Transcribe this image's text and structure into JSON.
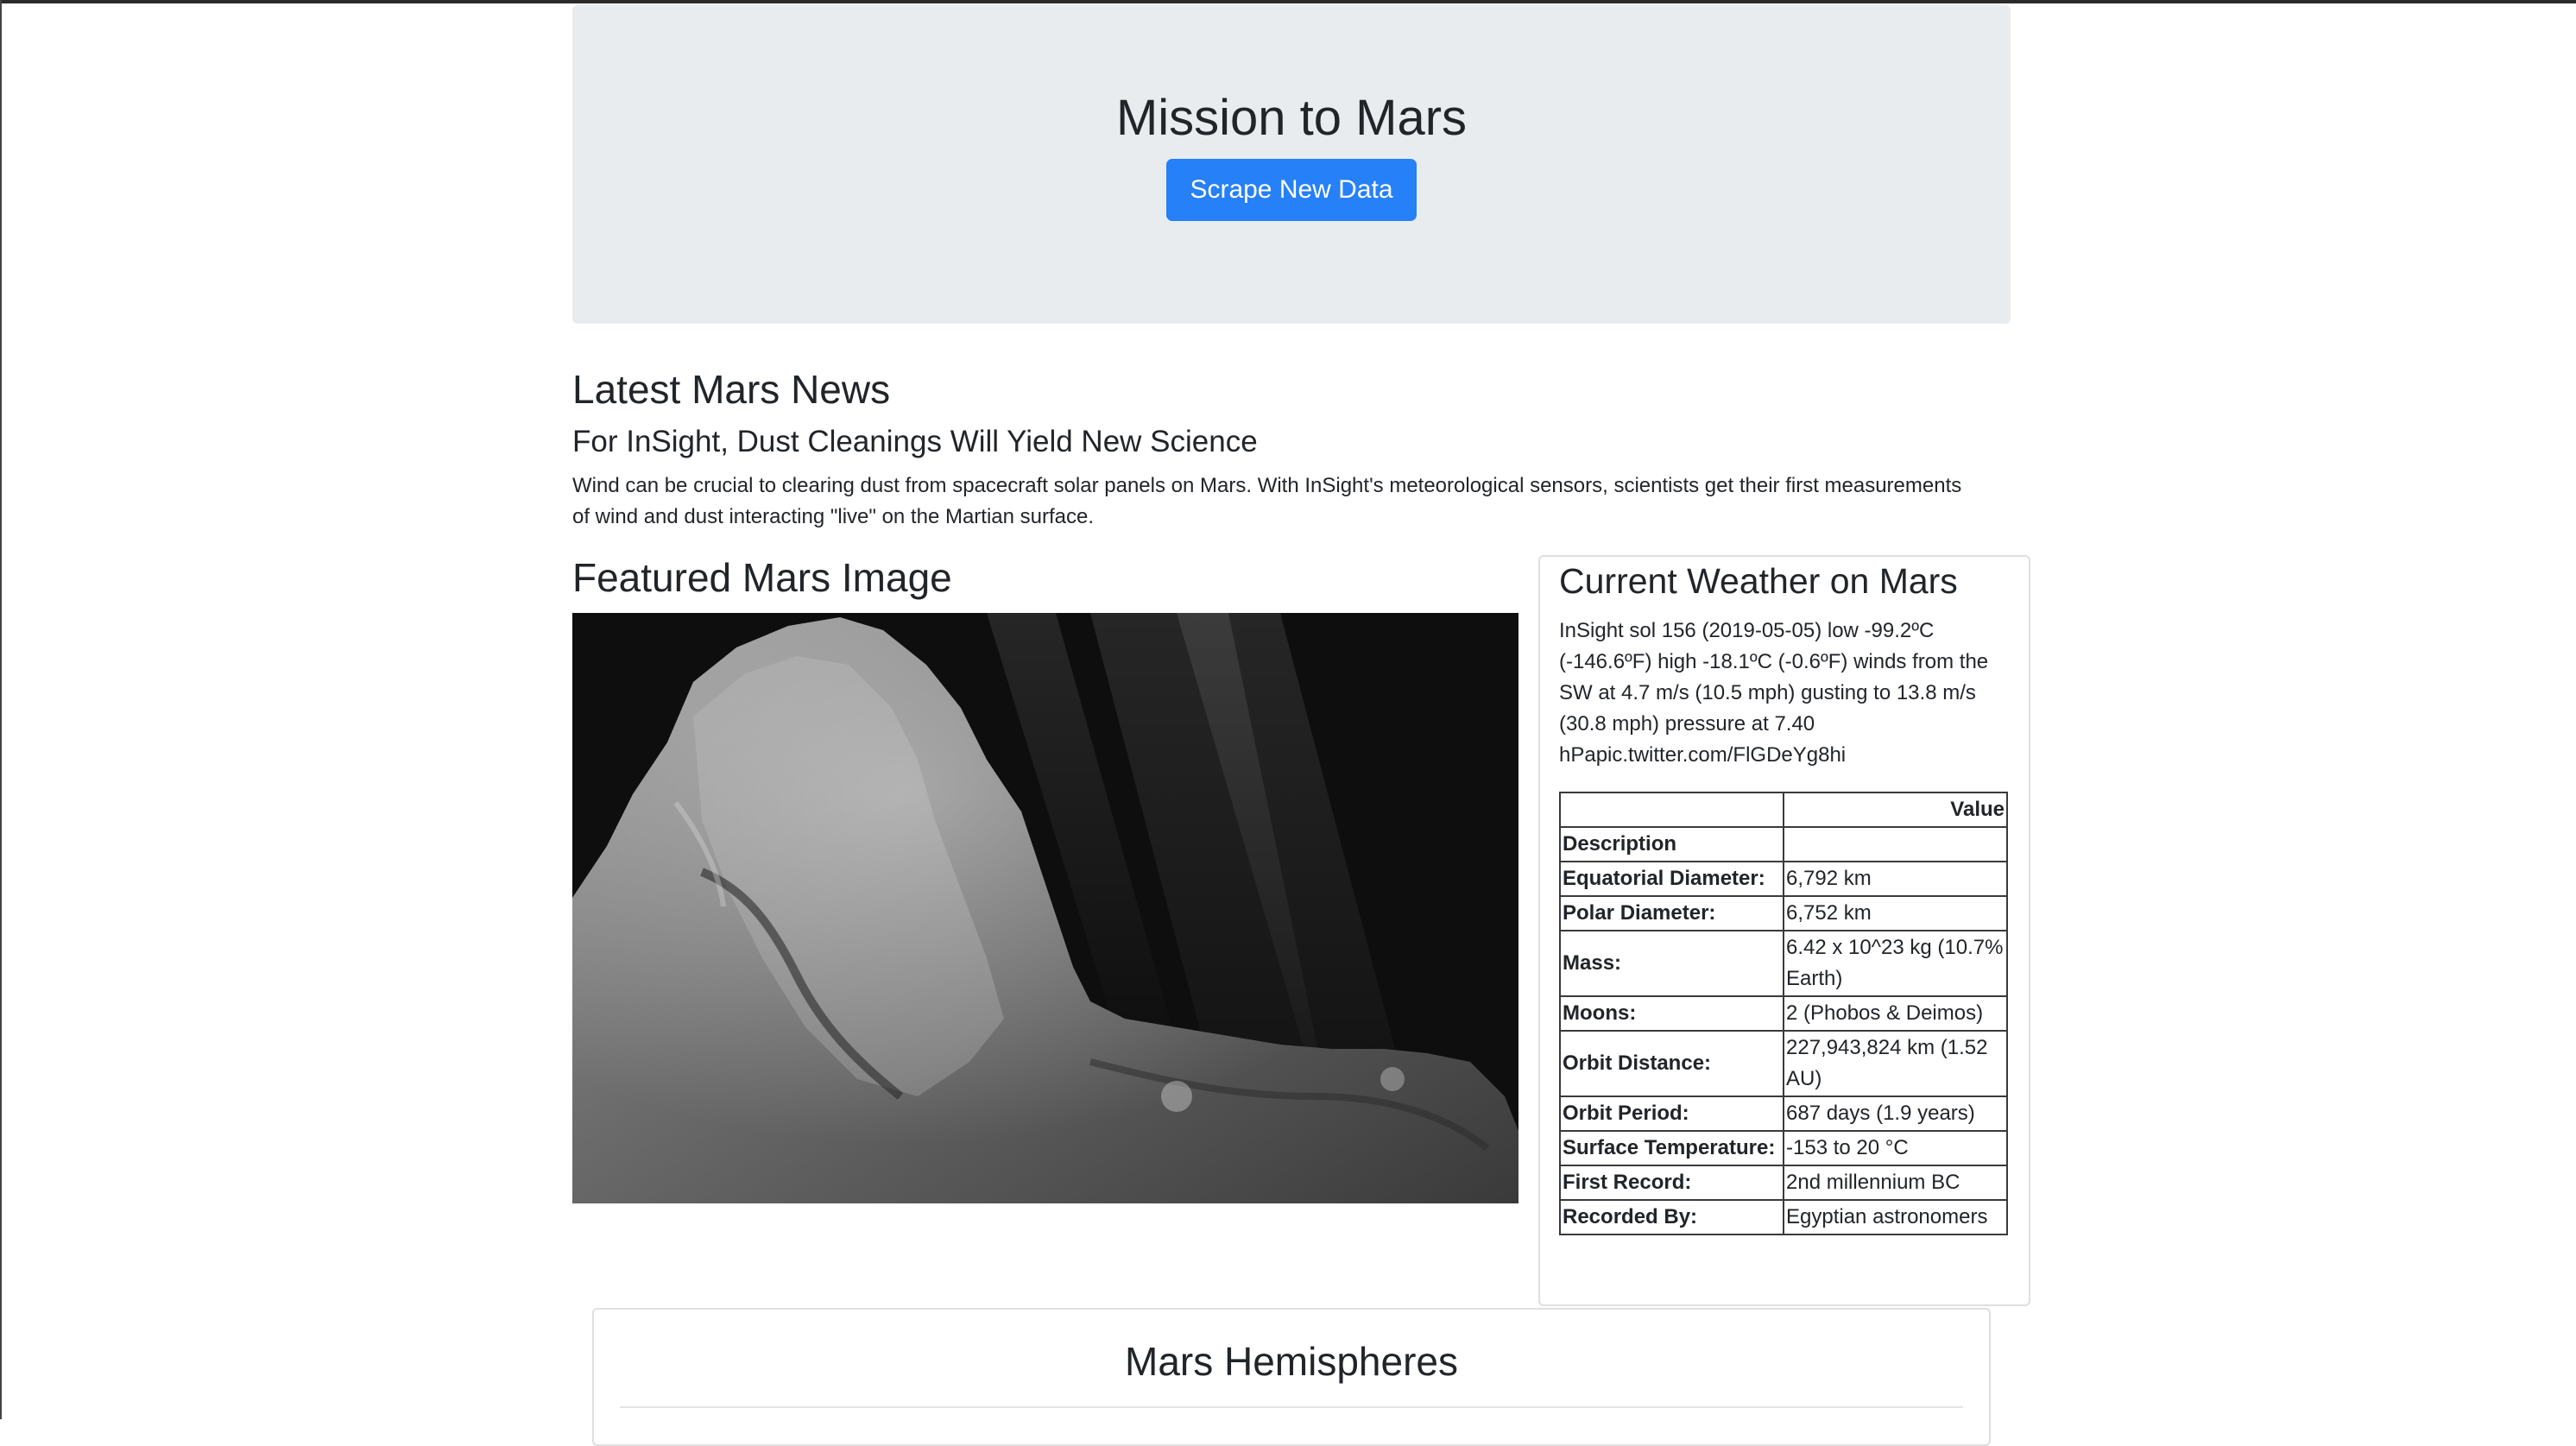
{
  "header": {
    "title": "Mission to Mars",
    "scrape_button_label": "Scrape New Data"
  },
  "news": {
    "section_heading": "Latest Mars News",
    "title": "For InSight, Dust Cleanings Will Yield New Science",
    "paragraph": "Wind can be crucial to clearing dust from spacecraft solar panels on Mars. With InSight's meteorological sensors, scientists get their first measurements of wind and dust interacting \"live\" on the Martian surface."
  },
  "featured_image": {
    "section_heading": "Featured Mars Image",
    "subject": "comet photograph (grayscale)"
  },
  "weather": {
    "section_heading": "Current Weather on Mars",
    "text": "InSight sol 156 (2019-05-05) low -99.2ºC (-146.6ºF) high -18.1ºC (-0.6ºF) winds from the SW at 4.7 m/s (10.5 mph) gusting to 13.8 m/s (30.8 mph) pressure at 7.40 hPapic.twitter.com/FlGDeYg8hi"
  },
  "facts_table": {
    "value_header": "Value",
    "rows": [
      {
        "label": "Description",
        "value": ""
      },
      {
        "label": "Equatorial Diameter:",
        "value": "6,792 km"
      },
      {
        "label": "Polar Diameter:",
        "value": "6,752 km"
      },
      {
        "label": "Mass:",
        "value": "6.42 x 10^23 kg (10.7% Earth)"
      },
      {
        "label": "Moons:",
        "value": "2 (Phobos & Deimos)"
      },
      {
        "label": "Orbit Distance:",
        "value": "227,943,824 km (1.52 AU)"
      },
      {
        "label": "Orbit Period:",
        "value": "687 days (1.9 years)"
      },
      {
        "label": "Surface Temperature:",
        "value": "-153 to 20 °C"
      },
      {
        "label": "First Record:",
        "value": "2nd millennium BC"
      },
      {
        "label": "Recorded By:",
        "value": "Egyptian astronomers"
      }
    ]
  },
  "hemispheres": {
    "section_heading": "Mars Hemispheres"
  },
  "colors": {
    "button": "#2680f7",
    "jumbotron_bg": "#e9ecef",
    "text": "#212529"
  }
}
